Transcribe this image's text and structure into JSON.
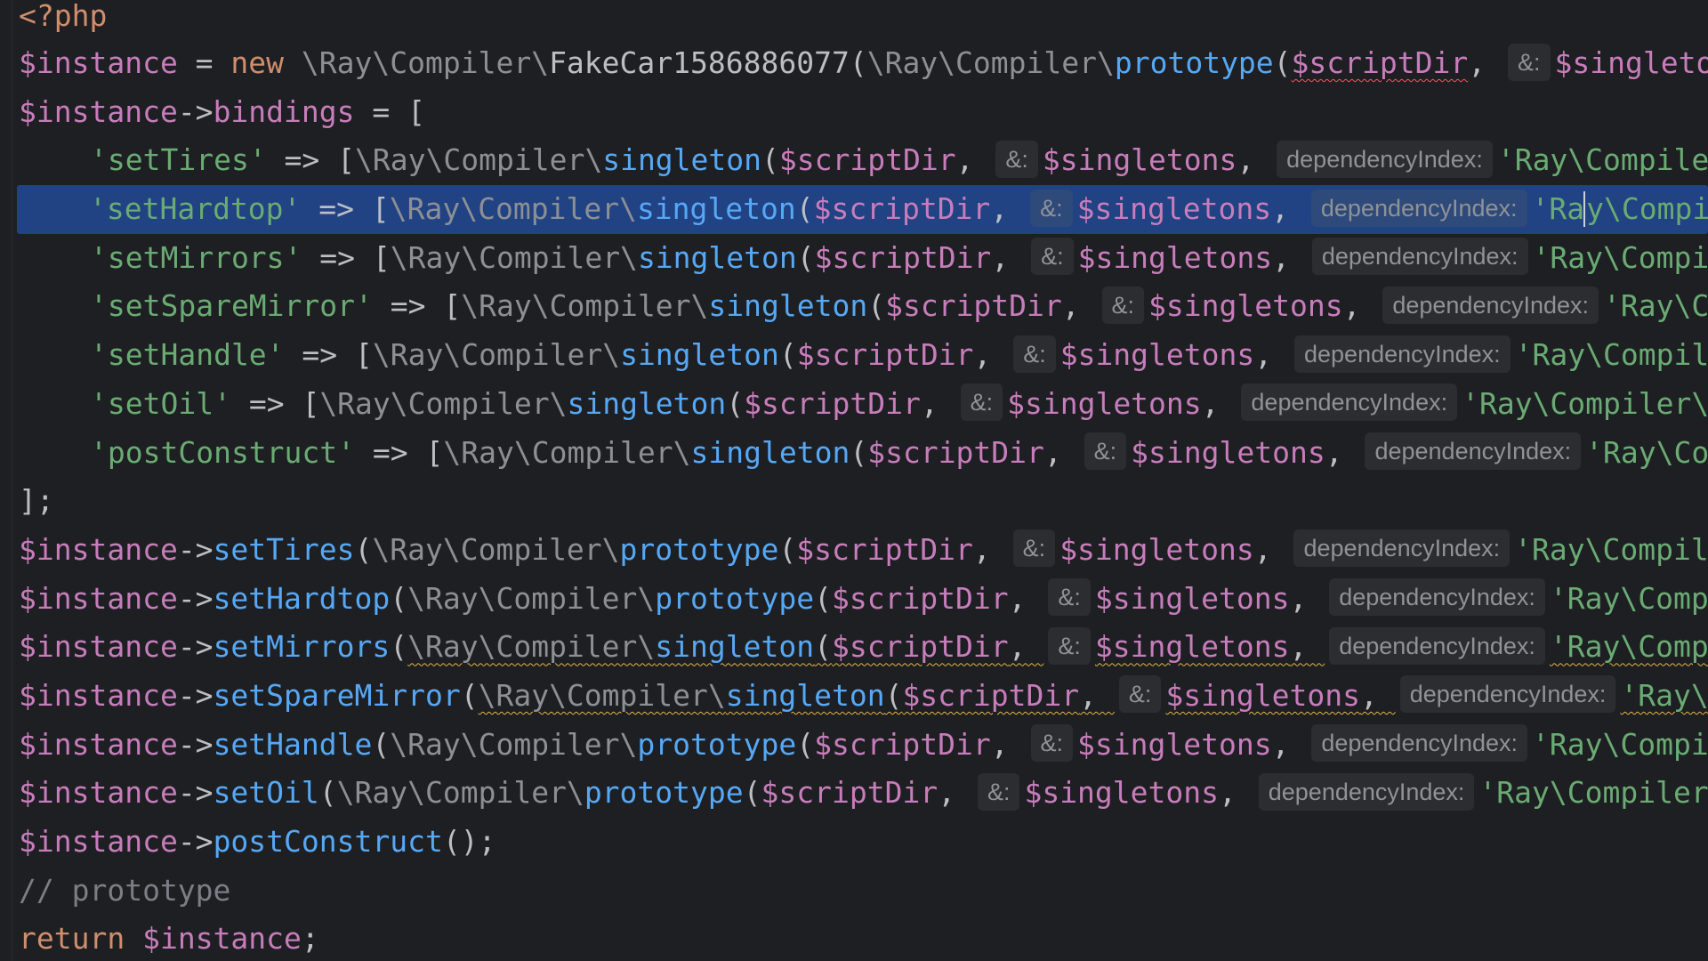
{
  "editor": {
    "language": "php",
    "colors": {
      "background": "#1e1f22",
      "selection": "#214283",
      "keyword": "#cf8e6d",
      "variable": "#c77dbb",
      "function": "#56a8f5",
      "string": "#6aab73",
      "namespace": "#8c8f94",
      "inlay_hint_bg": "#2b2d30",
      "error_underline": "#f75464",
      "warning_underline": "#e0b54a"
    },
    "tokens": {
      "open_tag": "<?php",
      "instance": "$instance",
      "new_kw": "new",
      "return_kw": "return",
      "assign": " = ",
      "arrow": "->",
      "fat_arrow": " => ",
      "open_bracket": "[",
      "open_paren": "(",
      "close_bracket_semi": "];",
      "call_end": "();",
      "comma": ", ",
      "semicolon": ";",
      "space": " ",
      "ns_prefix": "\\Ray\\Compiler\\",
      "fake_class": "FakeCar1586886077",
      "prototype_fn": "prototype",
      "singleton_fn": "singleton",
      "script_dir": "$scriptDir",
      "singletons": "$singletons",
      "bindings": "bindings",
      "hint_ref": "&:",
      "hint_dep": "dependencyIndex:",
      "comment_prototype": "// prototype",
      "post_construct_fn": "postConstruct"
    },
    "bindings": [
      {
        "key": "'setTires'",
        "dep": "'Ray\\Compile"
      },
      {
        "key": "'setHardtop'",
        "dep_before_caret": "'Ra",
        "dep_after_caret": "y\\Compi"
      },
      {
        "key": "'setMirrors'",
        "dep": "'Ray\\Compi"
      },
      {
        "key": "'setSpareMirror'",
        "dep": "'Ray\\C"
      },
      {
        "key": "'setHandle'",
        "dep": "'Ray\\Compil"
      },
      {
        "key": "'setOil'",
        "dep": "'Ray\\Compiler\\"
      },
      {
        "key": "'postConstruct'",
        "dep": "'Ray\\Co"
      }
    ],
    "header_line": {
      "singletons_tail": "$singletons"
    },
    "calls": [
      {
        "method": "setTires",
        "fn": "prototype",
        "dep": "'Ray\\Compil"
      },
      {
        "method": "setHardtop",
        "fn": "prototype",
        "dep": "'Ray\\Comp"
      },
      {
        "method": "setMirrors",
        "fn": "singleton",
        "dep": "'Ray\\Comp"
      },
      {
        "method": "setSpareMirror",
        "fn": "singleton",
        "dep": "'Ray\\"
      },
      {
        "method": "setHandle",
        "fn": "prototype",
        "dep": "'Ray\\Compi"
      },
      {
        "method": "setOil",
        "fn": "prototype",
        "dep": "'Ray\\Compiler"
      }
    ]
  }
}
